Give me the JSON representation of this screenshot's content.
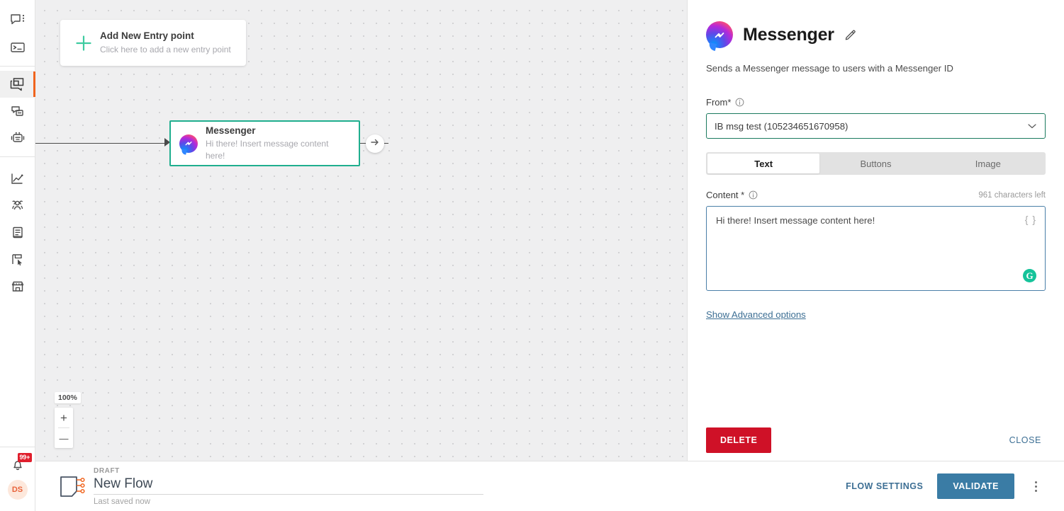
{
  "sidebar": {
    "groups": [
      {
        "items": [
          {
            "name": "chat-menu-icon",
            "label": "Conversations"
          },
          {
            "name": "terminal-icon",
            "label": "Console"
          }
        ]
      },
      {
        "items": [
          {
            "name": "flows-icon",
            "label": "Flows",
            "active": true
          },
          {
            "name": "templates-icon",
            "label": "Templates"
          },
          {
            "name": "bot-icon",
            "label": "Bots"
          }
        ]
      },
      {
        "items": [
          {
            "name": "analytics-icon",
            "label": "Analytics"
          },
          {
            "name": "audience-icon",
            "label": "Audience"
          },
          {
            "name": "book-icon",
            "label": "Content"
          },
          {
            "name": "campaign-icon",
            "label": "Campaigns"
          },
          {
            "name": "store-icon",
            "label": "Store"
          }
        ]
      }
    ],
    "notifications": {
      "badge": "99+",
      "icon": "bell-icon"
    },
    "avatar": {
      "initials": "DS"
    }
  },
  "canvas": {
    "entry_point": {
      "title": "Add New Entry point",
      "subtitle": "Click here to add a new entry point",
      "icon": "plus-icon"
    },
    "node": {
      "title": "Messenger",
      "subtitle": "Hi there! Insert message content here!",
      "icon": "messenger-icon",
      "add_next_icon": "arrow-right-icon"
    },
    "zoom": {
      "level": "100%",
      "zoom_in": "+",
      "zoom_out": "—"
    }
  },
  "panel": {
    "icon": "messenger-icon",
    "title": "Messenger",
    "edit_icon": "pencil-icon",
    "description": "Sends a Messenger message to users with a Messenger ID",
    "from": {
      "label": "From*",
      "info_icon": "info-icon",
      "value": "IB msg test (105234651670958)",
      "chevron_icon": "chevron-down-icon"
    },
    "tabs": [
      {
        "label": "Text",
        "active": true
      },
      {
        "label": "Buttons",
        "active": false
      },
      {
        "label": "Image",
        "active": false
      }
    ],
    "content": {
      "label": "Content *",
      "info_icon": "info-icon",
      "characters_left": "961 characters left",
      "value": "Hi there! Insert message content here!",
      "variable_icon": "{ }",
      "grammarly_icon": "G"
    },
    "advanced_link": "Show Advanced options",
    "delete_label": "DELETE",
    "close_label": "CLOSE"
  },
  "bottombar": {
    "flow_icon": "flow-icon",
    "status": "DRAFT",
    "name": "New Flow",
    "saved": "Last saved now",
    "flow_settings_label": "FLOW SETTINGS",
    "validate_label": "VALIDATE",
    "more_icon": "kebab-menu-icon"
  },
  "colors": {
    "accent_green": "#1fae8e",
    "accent_orange": "#f0641e",
    "primary_blue": "#3a7ca5",
    "danger_red": "#cf1127",
    "link_blue": "#3d6f94",
    "select_border_green": "#1b7a5e",
    "badge_red": "#e01e2c",
    "grammarly_green": "#15c39a"
  }
}
